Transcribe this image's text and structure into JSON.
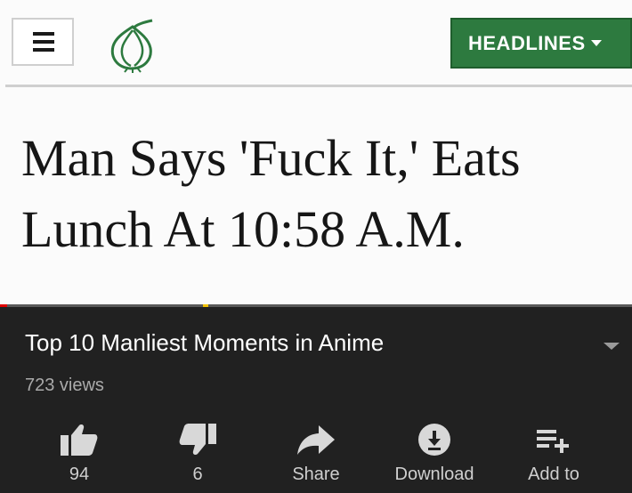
{
  "article": {
    "menu_icon": "hamburger-menu-icon",
    "logo_icon": "onion-logo-icon",
    "headlines_label": "HEADLINES",
    "title_line1": "Man Says 'Fuck It,' Eats",
    "title_line2": "Lunch At 10:58 A.M.",
    "colors": {
      "headlines_bg": "#2d7a3f",
      "logo_green": "#2d7a3f"
    }
  },
  "video": {
    "title": "Top 10 Manliest Moments in Anime",
    "views": "723 views",
    "colors": {
      "panel_bg": "#212121",
      "progress_played": "#e00000",
      "ad_marker": "#f2c200"
    },
    "actions": [
      {
        "icon": "thumbs-up-icon",
        "label": "94"
      },
      {
        "icon": "thumbs-down-icon",
        "label": "6"
      },
      {
        "icon": "share-arrow-icon",
        "label": "Share"
      },
      {
        "icon": "download-icon",
        "label": "Download"
      },
      {
        "icon": "add-to-playlist-icon",
        "label": "Add to"
      }
    ]
  }
}
